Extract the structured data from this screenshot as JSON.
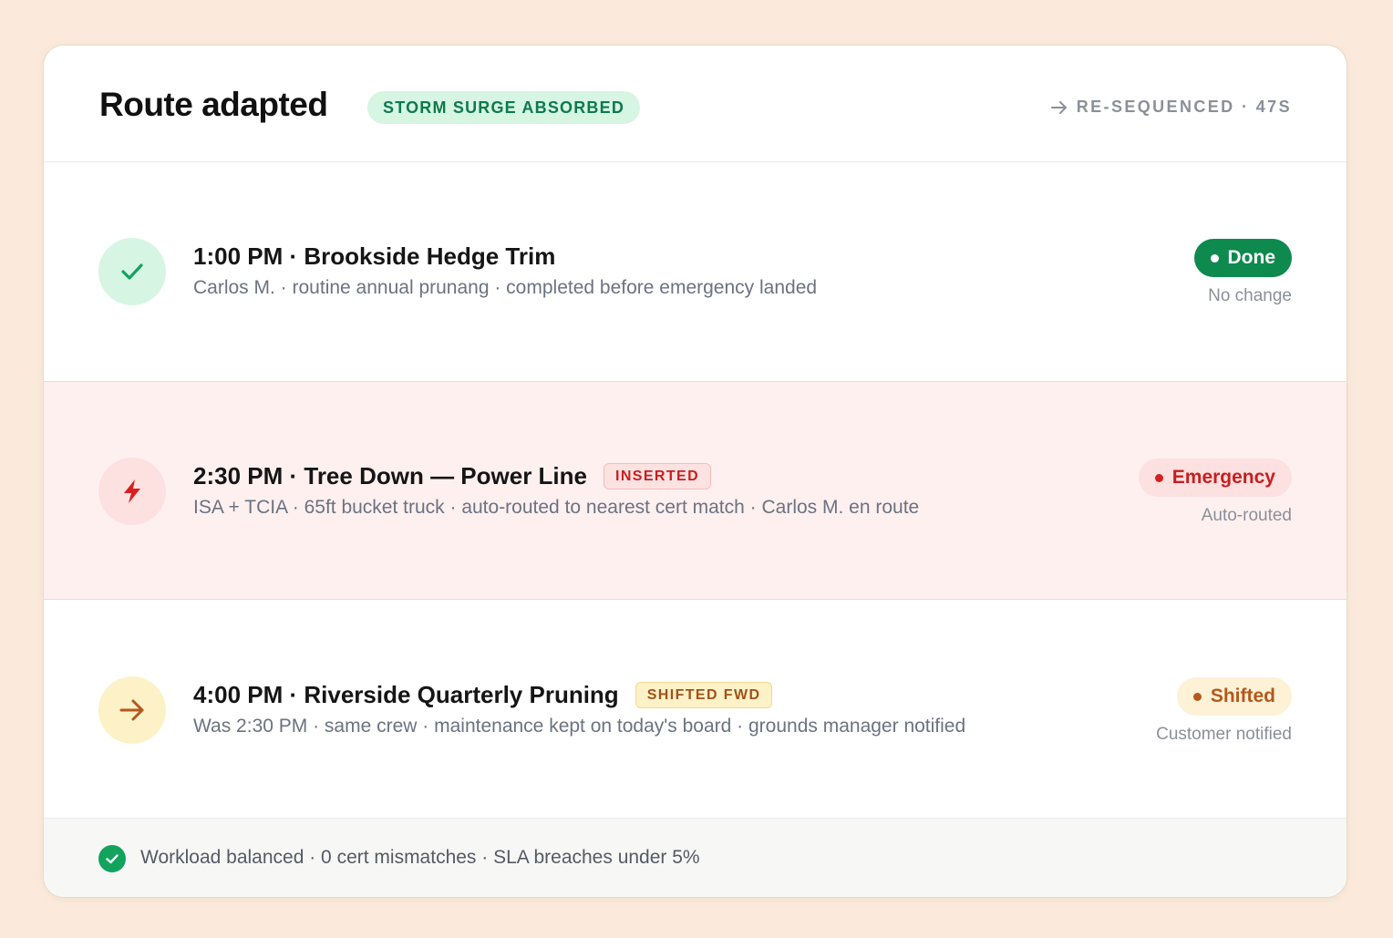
{
  "header": {
    "title": "Route adapted",
    "badge": "STORM SURGE ABSORBED",
    "resequenced": "RE-SEQUENCED · 47S",
    "resequenced_icon": "arrow-right-icon"
  },
  "rows": [
    {
      "icon": "checkmark-icon",
      "title": "1:00 PM · Brookside Hedge Trim",
      "tag": "",
      "subtitle": "Carlos M. · routine annual prunang · completed before emergency landed",
      "status": "Done",
      "status_note": "No change",
      "status_color": "#0e8a4f"
    },
    {
      "icon": "lightning-bolt-icon",
      "title": "2:30 PM · Tree Down — Power Line",
      "tag": "INSERTED",
      "subtitle": "ISA + TCIA · 65ft bucket truck · auto-routed to nearest cert match · Carlos M. en route",
      "status": "Emergency",
      "status_note": "Auto-routed",
      "status_color": "#c81e1e"
    },
    {
      "icon": "arrow-right-icon",
      "title": "4:00 PM · Riverside Quarterly Pruning",
      "tag": "SHIFTED FWD",
      "subtitle": "Was 2:30 PM · same crew · maintenance kept on today's board · grounds manager notified",
      "status": "Shifted",
      "status_note": "Customer notified",
      "status_color": "#b4581c"
    }
  ],
  "footer": {
    "icon": "check-circle-icon",
    "text": "Workload balanced · 0 cert mismatches · SLA breaches under 5%"
  },
  "colors": {
    "background": "#fbeadb",
    "accent_green": "#0e8a4f",
    "emergency_red": "#c81e1e",
    "shifted_orange": "#b4581c"
  }
}
